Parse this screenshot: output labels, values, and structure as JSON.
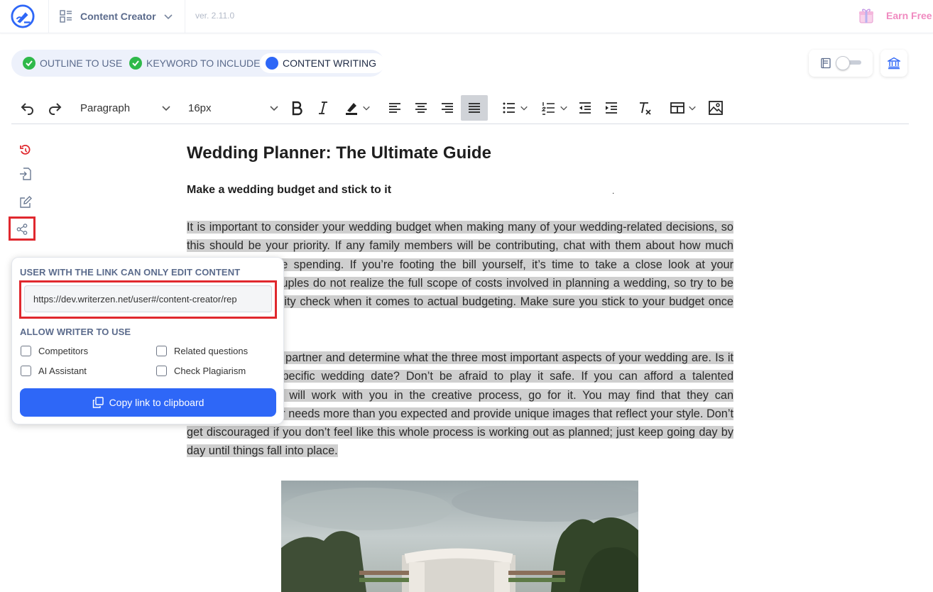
{
  "header": {
    "app_name": "Content Creator",
    "version": "ver. 2.11.0",
    "earn_label": "Earn Free C"
  },
  "steps": [
    {
      "label": "OUTLINE TO USE",
      "state": "done"
    },
    {
      "label": "KEYWORD TO INCLUDE",
      "state": "done"
    },
    {
      "label": "CONTENT WRITING",
      "state": "active"
    }
  ],
  "toolbar": {
    "block_format": "Paragraph",
    "font_size": "16px"
  },
  "document": {
    "title": "Wedding Planner: The Ultimate Guide",
    "subheading": "Make a wedding budget and stick to it",
    "stray_mark": ".",
    "paragraph_1": "It is important to consider your wedding budget when making many of your wedding-related decisions, so this should be your priority. If any family members will be contributing, chat with them about how much they’re comfortable spending. If you’re footing the bill yourself, it’s time to take a close look at your finances. Many couples do not realize the full scope of costs involved in planning a wedding, so try to be prepared for a reality check when it comes to actual budgeting. Make sure you stick to your budget once you have it.",
    "paragraph_2": "Sit down with your partner and determine what the three most important aspects of your wedding are. Is it the venue or a specific wedding date? Don’t be afraid to play it safe. If you can afford a talented photographer who will work with you in the creative process, go for it. You may find that they can accommodate your needs more than you expected and provide unique images that reflect your style. Don’t get discouraged if you don’t feel like this whole process is working out as planned; just keep going day by day until things fall into place."
  },
  "share_popup": {
    "link_label": "USER WITH THE LINK CAN ONLY EDIT CONTENT",
    "link_value": "https://dev.writerzen.net/user#/content-creator/rep",
    "allow_label": "ALLOW WRITER TO USE",
    "options": [
      {
        "label": "Competitors",
        "checked": false
      },
      {
        "label": "Related questions",
        "checked": false
      },
      {
        "label": "AI Assistant",
        "checked": false
      },
      {
        "label": "Check Plagiarism",
        "checked": false
      }
    ],
    "copy_button": "Copy link to clipboard"
  },
  "colors": {
    "primary": "#2e67f7",
    "success": "#2fb94a",
    "highlight_box": "#e0282e",
    "earn_text": "#f08ac0"
  }
}
